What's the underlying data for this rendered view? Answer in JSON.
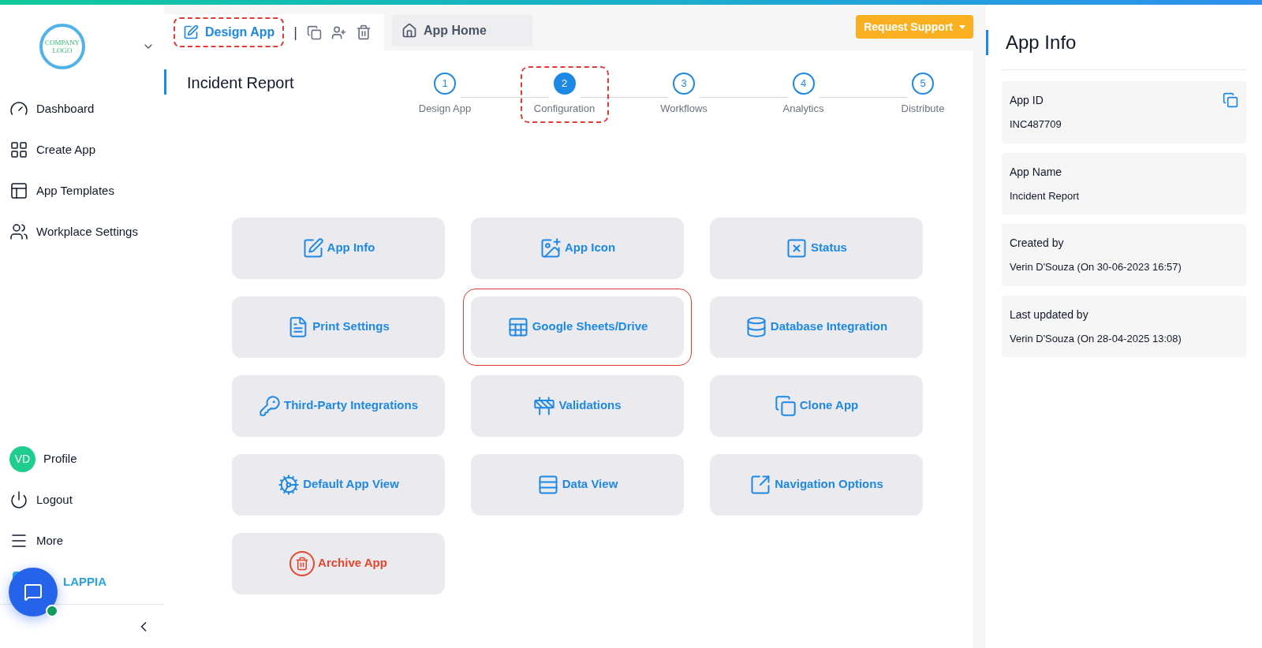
{
  "sidebar": {
    "logo_text": "COMPANY LOGO",
    "nav": [
      {
        "label": "Dashboard",
        "kind": "dashboard"
      },
      {
        "label": "Create App",
        "kind": "create"
      },
      {
        "label": "App Templates",
        "kind": "templates"
      },
      {
        "label": "Workplace Settings",
        "kind": "workplace"
      }
    ],
    "profile": {
      "initials": "VD",
      "label": "Profile"
    },
    "bottom": [
      {
        "label": "Logout",
        "kind": "logout"
      },
      {
        "label": "More",
        "kind": "more"
      }
    ],
    "brand": "LAPPIA"
  },
  "toolbar": {
    "design_tab": {
      "label": "Design App",
      "highlighted": true
    },
    "home_tab": {
      "label": "App Home"
    },
    "separator": "|",
    "support_button": "Request Support"
  },
  "page_title": "Incident Report",
  "steps": [
    {
      "number": "1",
      "label": "Design App",
      "selected": false,
      "highlighted": false
    },
    {
      "number": "2",
      "label": "Configuration",
      "selected": true,
      "highlighted": true
    },
    {
      "number": "3",
      "label": "Workflows",
      "selected": false,
      "highlighted": false
    },
    {
      "number": "4",
      "label": "Analytics",
      "selected": false,
      "highlighted": false
    },
    {
      "number": "5",
      "label": "Distribute",
      "selected": false,
      "highlighted": false
    }
  ],
  "cards": [
    {
      "label": "App Info",
      "kind": "normal",
      "highlighted": false
    },
    {
      "label": "App Icon",
      "kind": "normal",
      "highlighted": false
    },
    {
      "label": "Status",
      "kind": "normal",
      "highlighted": false
    },
    {
      "label": "Print Settings",
      "kind": "normal",
      "highlighted": false
    },
    {
      "label": "Google Sheets/Drive",
      "kind": "normal",
      "highlighted": true
    },
    {
      "label": "Database Integration",
      "kind": "normal",
      "highlighted": false
    },
    {
      "label": "Third-Party Integrations",
      "kind": "normal",
      "highlighted": false
    },
    {
      "label": "Validations",
      "kind": "normal",
      "highlighted": false
    },
    {
      "label": "Clone App",
      "kind": "normal",
      "highlighted": false
    },
    {
      "label": "Default App View",
      "kind": "normal",
      "highlighted": false
    },
    {
      "label": "Data View",
      "kind": "normal",
      "highlighted": false
    },
    {
      "label": "Navigation Options",
      "kind": "normal",
      "highlighted": false
    },
    {
      "label": "Archive App",
      "kind": "danger",
      "highlighted": false
    }
  ],
  "info_panel": {
    "title": "App Info",
    "fields": [
      {
        "label": "App ID",
        "value": "INC487709",
        "copyable": true
      },
      {
        "label": "App Name",
        "value": "Incident Report",
        "copyable": false
      },
      {
        "label": "Created by",
        "value": "Verin D'Souza (On 30-06-2023 16:57)",
        "copyable": false
      },
      {
        "label": "Last updated by",
        "value": "Verin D'Souza (On 28-04-2025 13:08)",
        "copyable": false
      }
    ]
  }
}
